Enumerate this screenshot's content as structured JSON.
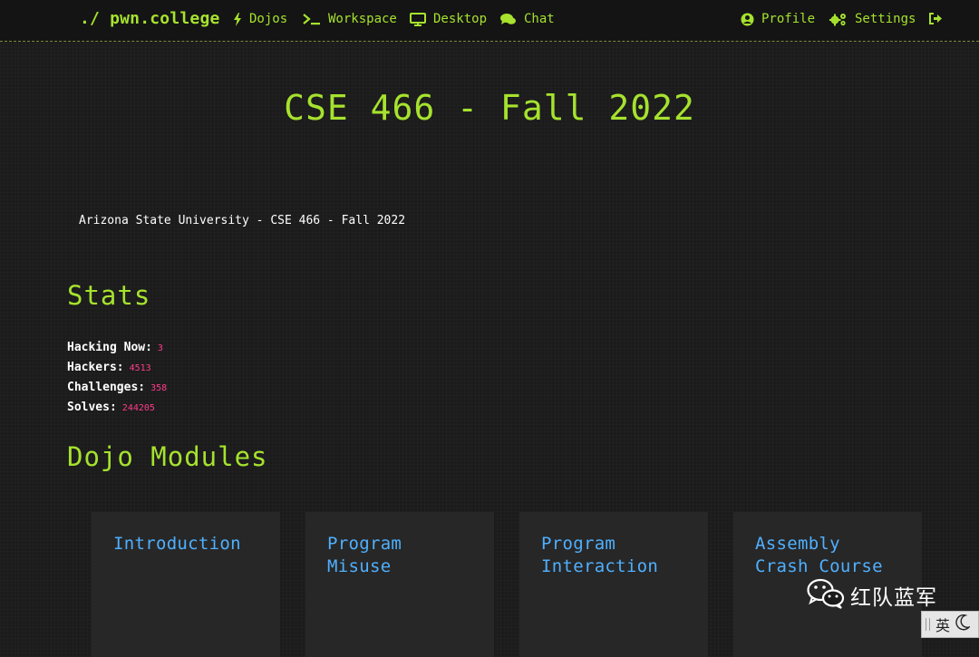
{
  "navbar": {
    "brand": "./ pwn.college",
    "items": [
      {
        "label": "Dojos",
        "icon": "bolt-icon"
      },
      {
        "label": "Workspace",
        "icon": "terminal-icon"
      },
      {
        "label": "Desktop",
        "icon": "desktop-icon"
      },
      {
        "label": "Chat",
        "icon": "comments-icon"
      }
    ],
    "right_items": [
      {
        "label": "Profile",
        "icon": "user-circle-icon"
      },
      {
        "label": "Settings",
        "icon": "cogs-icon"
      },
      {
        "label": "",
        "icon": "sign-out-icon"
      }
    ]
  },
  "page": {
    "title": "CSE 466 - Fall 2022",
    "description": "Arizona State University - CSE 466 - Fall 2022"
  },
  "stats": {
    "heading": "Stats",
    "rows": [
      {
        "label": "Hacking Now:",
        "value": "3"
      },
      {
        "label": "Hackers:",
        "value": "4513"
      },
      {
        "label": "Challenges:",
        "value": "358"
      },
      {
        "label": "Solves:",
        "value": "244205"
      }
    ]
  },
  "modules": {
    "heading": "Dojo Modules",
    "cards": [
      {
        "line1": "Introduction",
        "line2": ""
      },
      {
        "line1": "Program",
        "line2": "Misuse"
      },
      {
        "line1": "Program",
        "line2": "Interaction"
      },
      {
        "line1": "Assembly",
        "line2": "Crash Course"
      }
    ]
  },
  "watermark": {
    "text": "红队蓝军",
    "icon": "wechat-icon"
  },
  "ime": {
    "lang": "英",
    "icon": "moon-icon"
  },
  "colors": {
    "accent": "#a6e22e",
    "module_title": "#4fb0ff",
    "stat_value": "#ff3d8a",
    "background": "#1b1b1b",
    "card": "#272727"
  }
}
